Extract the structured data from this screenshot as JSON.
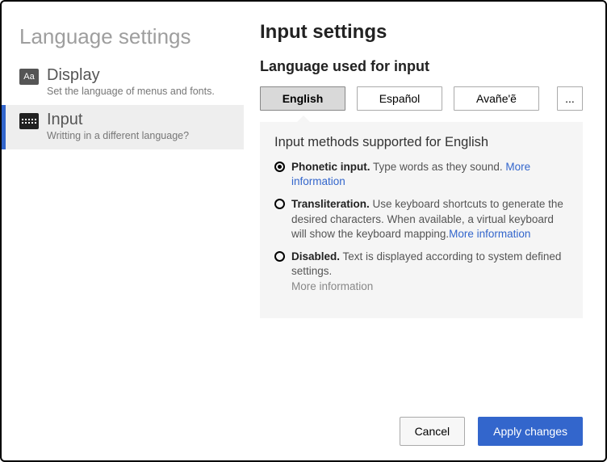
{
  "sidebar": {
    "title": "Language settings",
    "items": [
      {
        "label": "Display",
        "desc": "Set the language of menus and fonts."
      },
      {
        "label": "Input",
        "desc": "Writting in a different language?"
      }
    ]
  },
  "main": {
    "title": "Input settings",
    "section_title": "Language used for input",
    "tabs": [
      "English",
      "Español",
      "Avañe'ẽ"
    ],
    "more_tab": "...",
    "methods_title": "Input methods supported for English",
    "methods": [
      {
        "label": "Phonetic input.",
        "desc": " Type words as they sound. ",
        "more": "More information",
        "more_enabled": true,
        "checked": true
      },
      {
        "label": "Transliteration.",
        "desc": " Use keyboard shortcuts to generate the desired characters. When available, a virtual keyboard will show the keyboard mapping.",
        "more": "More information",
        "more_enabled": true,
        "checked": false
      },
      {
        "label": "Disabled.",
        "desc": " Text is displayed according to system defined settings. ",
        "more": "More information",
        "more_enabled": false,
        "checked": false
      }
    ]
  },
  "footer": {
    "cancel": "Cancel",
    "apply": "Apply changes"
  }
}
